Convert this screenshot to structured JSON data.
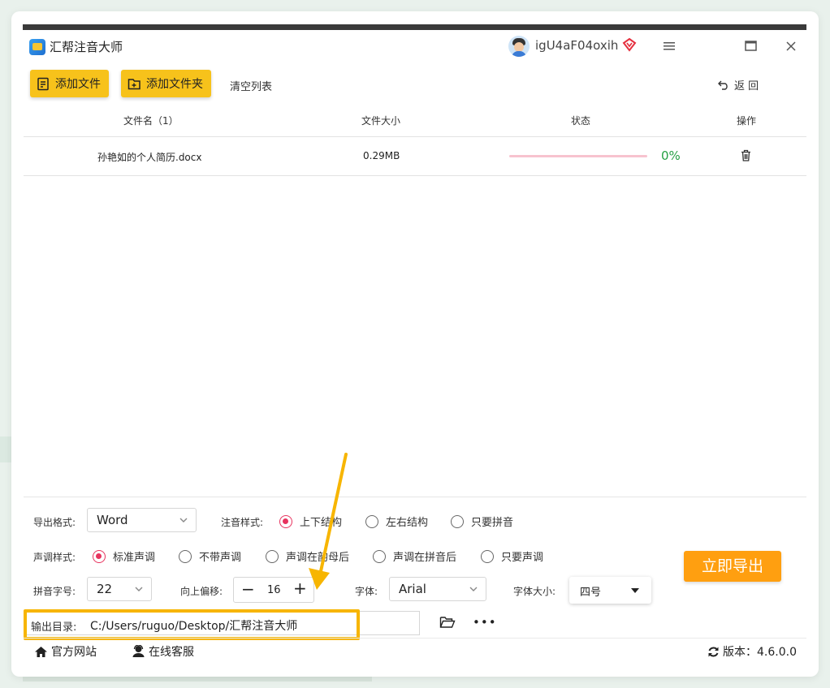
{
  "app": {
    "title": "汇帮注音大师",
    "username": "igU4aF04oxih"
  },
  "toolbar": {
    "add_file": "添加文件",
    "add_folder": "添加文件夹",
    "clear_list": "清空列表",
    "back": "返 回"
  },
  "table": {
    "headers": [
      "文件名（1）",
      "文件大小",
      "状态",
      "操作"
    ],
    "rows": [
      {
        "filename": "孙艳如的个人简历.docx",
        "size": "0.29MB",
        "progress": 0,
        "progress_text": "0%"
      }
    ]
  },
  "settings": {
    "export_format_label": "导出格式:",
    "export_format_value": "Word",
    "annotation_style_label": "注音样式:",
    "annotation_options": [
      "上下结构",
      "左右结构",
      "只要拼音"
    ],
    "annotation_selected": "上下结构",
    "tone_style_label": "声调样式:",
    "tone_options": [
      "标准声调",
      "不带声调",
      "声调在韵母后",
      "声调在拼音后",
      "只要声调"
    ],
    "tone_selected": "标准声调",
    "pinyin_size_label": "拼音字号:",
    "pinyin_size_value": "22",
    "offset_label": "向上偏移:",
    "offset_value": "16",
    "font_label": "字体:",
    "font_value": "Arial",
    "font_size_label": "字体大小:",
    "font_size_value": "四号",
    "export_now": "立即导出",
    "output_dir_label": "输出目录:",
    "output_dir_value": "C:/Users/ruguo/Desktop/汇帮注音大师"
  },
  "footer": {
    "official_site": "官方网站",
    "online_service": "在线客服",
    "version": "版本：4.6.0.0"
  },
  "colors": {
    "accent_yellow": "#f7c21b",
    "export_orange": "#ff9f10",
    "radio_pink": "#e7335e",
    "progress_green": "#26a044",
    "highlight": "#f7b500"
  }
}
